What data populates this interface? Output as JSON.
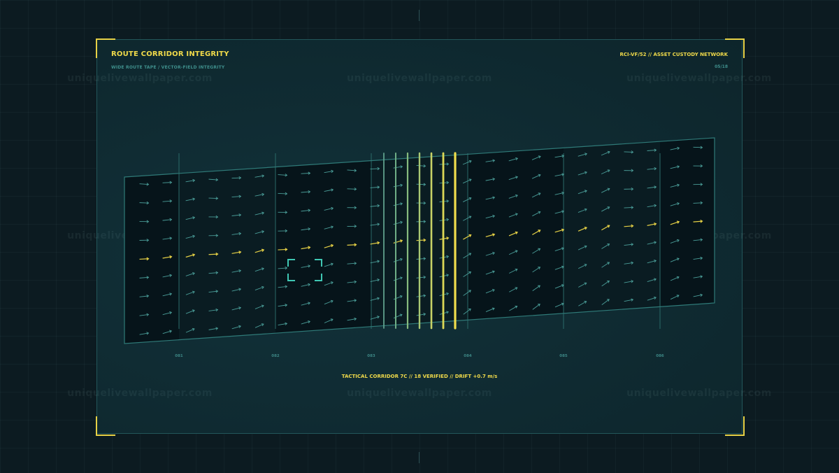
{
  "header": {
    "title": "ROUTE CORRIDOR INTEGRITY",
    "subtitle": "WIDE ROUTE TAPE / VECTOR-FIELD INTEGRITY",
    "network": "RCI-VF/52  //  ASSET CUSTODY NETWORK",
    "page_index": "05/18"
  },
  "watermark": "uniquelivewallpaper.com",
  "segments": [
    "081",
    "082",
    "083",
    "084",
    "085",
    "086"
  ],
  "footer": "TACTICAL CORRIDOR 7C  //  18 VERIFIED  //  DRIFT +0.7 m/s",
  "colors": {
    "accent": "#f0da4a",
    "teal": "#4ba3a0",
    "frame": "#23565a",
    "background": "#0c1b21"
  }
}
